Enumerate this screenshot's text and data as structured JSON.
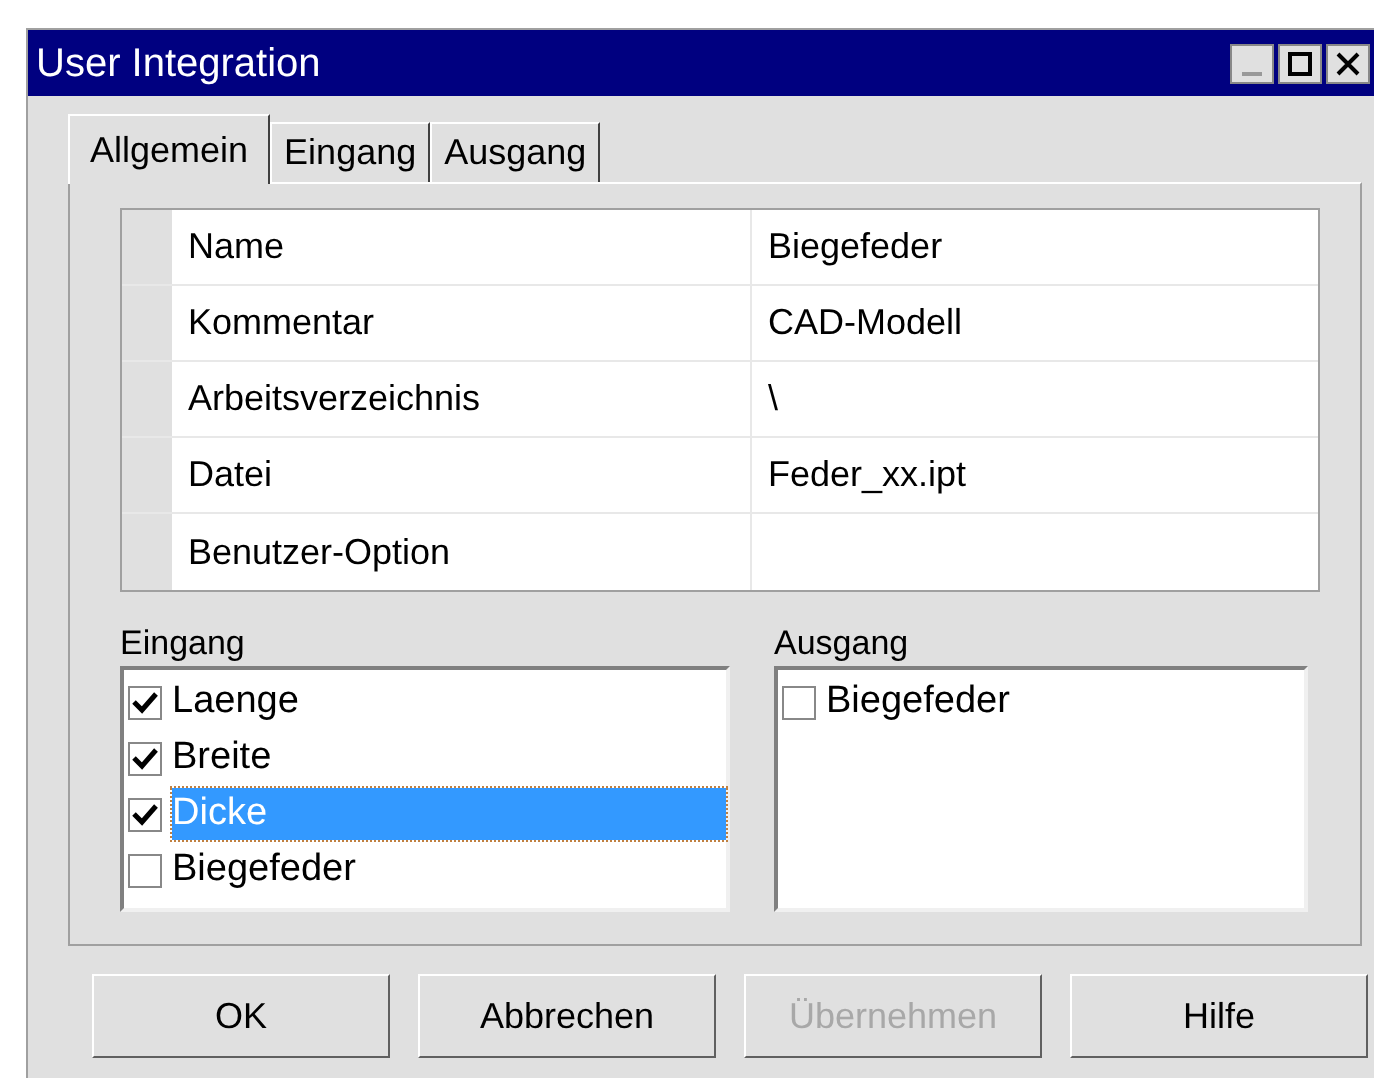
{
  "window": {
    "title": "User Integration"
  },
  "tabs": [
    {
      "label": "Allgemein",
      "selected": true
    },
    {
      "label": "Eingang",
      "selected": false
    },
    {
      "label": "Ausgang",
      "selected": false
    }
  ],
  "properties": [
    {
      "name": "Name",
      "value": "Biegefeder"
    },
    {
      "name": "Kommentar",
      "value": "CAD-Modell"
    },
    {
      "name": "Arbeitsverzeichnis",
      "value": "\\"
    },
    {
      "name": "Datei",
      "value": "Feder_xx.ipt"
    },
    {
      "name": "Benutzer-Option"
    }
  ],
  "eingang": {
    "label": "Eingang",
    "items": [
      {
        "label": "Laenge",
        "checked": true,
        "selected": false
      },
      {
        "label": "Breite",
        "checked": true,
        "selected": false
      },
      {
        "label": "Dicke",
        "checked": true,
        "selected": true
      },
      {
        "label": "Biegefeder",
        "checked": false,
        "selected": false
      }
    ]
  },
  "ausgang": {
    "label": "Ausgang",
    "items": [
      {
        "label": "Biegefeder",
        "checked": false,
        "selected": false
      }
    ]
  },
  "buttons": [
    {
      "label": "OK",
      "disabled": false
    },
    {
      "label": "Abbrechen",
      "disabled": false
    },
    {
      "label": "Übernehmen",
      "disabled": true
    },
    {
      "label": "Hilfe",
      "disabled": false
    }
  ]
}
